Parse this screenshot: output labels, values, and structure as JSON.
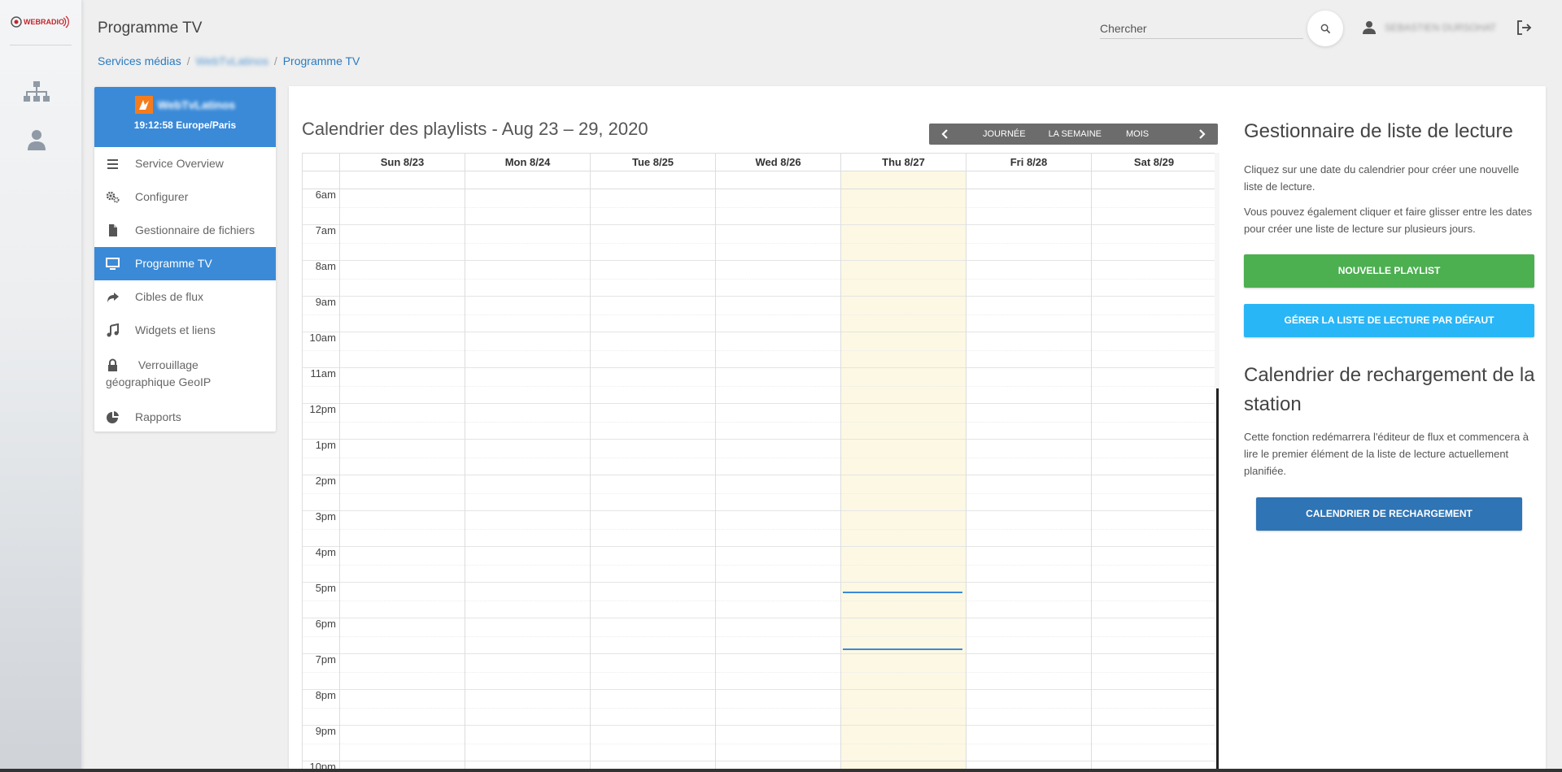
{
  "rail": {
    "logo_text": "WEBRADIO"
  },
  "header": {
    "title": "Programme TV",
    "search_placeholder": "Chercher",
    "user_name": "SEBASTIEN DURSOHAT"
  },
  "breadcrumb": [
    "Services médias",
    "WebTvLatinos",
    "Programme TV"
  ],
  "service": {
    "name": "WebTvLatinos",
    "clock": "19:12:58 Europe/Paris",
    "menu": [
      {
        "label": "Service Overview",
        "icon": "list-icon"
      },
      {
        "label": "Configurer",
        "icon": "gears-icon"
      },
      {
        "label": "Gestionnaire de fichiers",
        "icon": "file-icon"
      },
      {
        "label": "Programme TV",
        "icon": "monitor-icon",
        "active": true
      },
      {
        "label": "Cibles de flux",
        "icon": "share-icon"
      },
      {
        "label": "Widgets et liens",
        "icon": "music-icon"
      },
      {
        "label": "Verrouillage géographique GeoIP",
        "icon": "lock-icon"
      },
      {
        "label": "Rapports",
        "icon": "pie-chart-icon"
      }
    ]
  },
  "calendar": {
    "title": "Calendrier des playlists - Aug 23 – 29, 2020",
    "views": {
      "day": "JOURNÉE",
      "week": "LA SEMAINE",
      "month": "MOIS"
    },
    "days": [
      "Sun 8/23",
      "Mon 8/24",
      "Tue 8/25",
      "Wed 8/26",
      "Thu 8/27",
      "Fri 8/28",
      "Sat 8/29"
    ],
    "today_index": 4,
    "hours": [
      "6am",
      "7am",
      "8am",
      "9am",
      "10am",
      "11am",
      "12pm",
      "1pm",
      "2pm",
      "3pm",
      "4pm",
      "5pm",
      "6pm",
      "7pm",
      "8pm",
      "9pm",
      "10pm"
    ]
  },
  "sidebar": {
    "playlist_manager_title": "Gestionnaire de liste de lecture",
    "text1": "Cliquez sur une date du calendrier pour créer une nouvelle liste de lecture.",
    "text2": "Vous pouvez également cliquer et faire glisser entre les dates pour créer une liste de lecture sur plusieurs jours.",
    "new_playlist_btn": "NOUVELLE PLAYLIST",
    "default_playlist_btn": "GÉRER LA LISTE DE LECTURE PAR DÉFAUT",
    "reload_title": "Calendrier de rechargement de la station",
    "reload_text": "Cette fonction redémarrera l'éditeur de flux et commencera à lire le premier élément de la liste de lecture actuellement planifiée.",
    "reload_btn": "CALENDRIER DE RECHARGEMENT"
  },
  "colors": {
    "primary": "#3a8ad8",
    "green": "#4caf50",
    "cyan": "#29b6f6",
    "dark_blue": "#2f74b5",
    "today_bg": "#fcf8e3"
  }
}
